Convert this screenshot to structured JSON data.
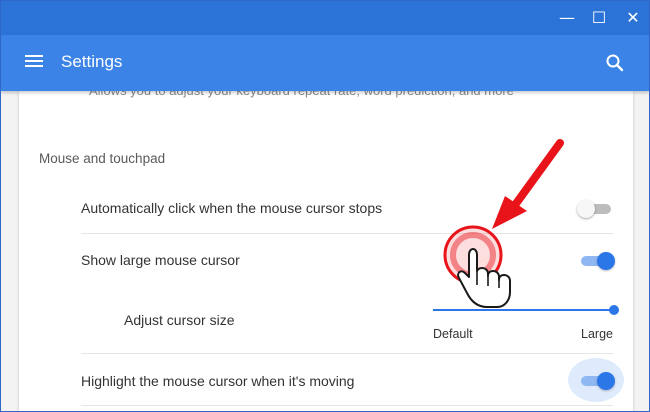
{
  "window": {
    "minimize_glyph": "—",
    "maximize_glyph": "☐",
    "close_glyph": "✕"
  },
  "header": {
    "title": "Settings",
    "menu_icon": "hamburger-menu-icon",
    "search_icon": "search-icon",
    "color": "#3b83e6"
  },
  "partial_text": "Allows you to adjust your keyboard repeat rate, word prediction, and more",
  "section": {
    "title": "Mouse and touchpad",
    "rows": [
      {
        "label": "Automatically click when the mouse cursor stops",
        "enabled": false
      },
      {
        "label": "Show large mouse cursor",
        "enabled": true
      },
      {
        "label": "Adjust cursor size",
        "min_label": "Default",
        "max_label": "Large",
        "value_fraction": 1.0
      },
      {
        "label": "Highlight the mouse cursor when it's moving",
        "enabled": true
      }
    ]
  },
  "annotation": {
    "arrow_color": "#e8141a",
    "highlight_color": "#e8141a",
    "cursor_icon": "hand-pointer-icon"
  }
}
